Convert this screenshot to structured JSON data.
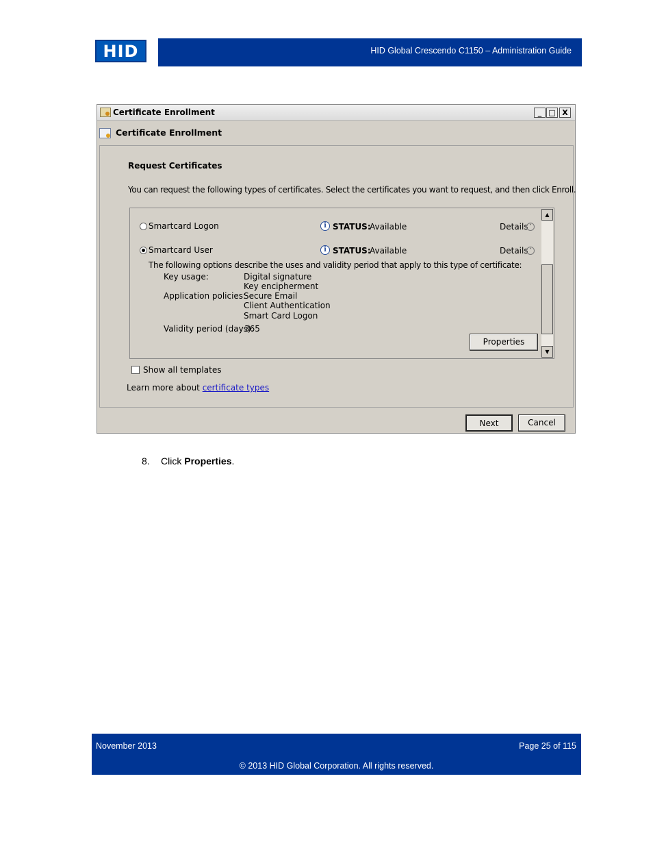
{
  "header": {
    "logo_text": "HID",
    "doc_title": "HID Global Crescendo C1150  – Administration Guide"
  },
  "window": {
    "title": "Certificate Enrollment",
    "heading": "Certificate Enrollment",
    "min_glyph": "_",
    "max_glyph": "□",
    "close_glyph": "X",
    "section_title": "Request Certificates",
    "description": "You can request the following types of certificates. Select the certificates you want to request, and then click Enroll.",
    "templates": [
      {
        "name": "Smartcard Logon",
        "selected": false,
        "status_label": "STATUS:",
        "status_value": "Available",
        "details_label": "Details",
        "details_glyph": "˅"
      },
      {
        "name": "Smartcard User",
        "selected": true,
        "status_label": "STATUS:",
        "status_value": "Available",
        "details_label": "Details",
        "details_glyph": "˄"
      }
    ],
    "options_intro": "The following options describe the uses and validity period that apply to this type of certificate:",
    "key_usage_label": "Key usage:",
    "key_usage_values": [
      "Digital signature",
      "Key encipherment"
    ],
    "app_policies_label": "Application policies:",
    "app_policies_values": [
      "Secure Email",
      "Client Authentication",
      "Smart Card Logon"
    ],
    "validity_label": "Validity period (days):",
    "validity_value": "365",
    "properties_button": "Properties",
    "show_all_label": "Show all templates",
    "learn_more_prefix": "Learn more about ",
    "learn_more_link": "certificate types",
    "next_button": "Next",
    "cancel_button": "Cancel"
  },
  "step": {
    "number": "8.",
    "prefix": "Click ",
    "bold": "Properties",
    "suffix": "."
  },
  "footer": {
    "date": "November 2013",
    "page": "Page 25 of 115",
    "copyright": "© 2013 HID Global Corporation. All rights reserved."
  }
}
